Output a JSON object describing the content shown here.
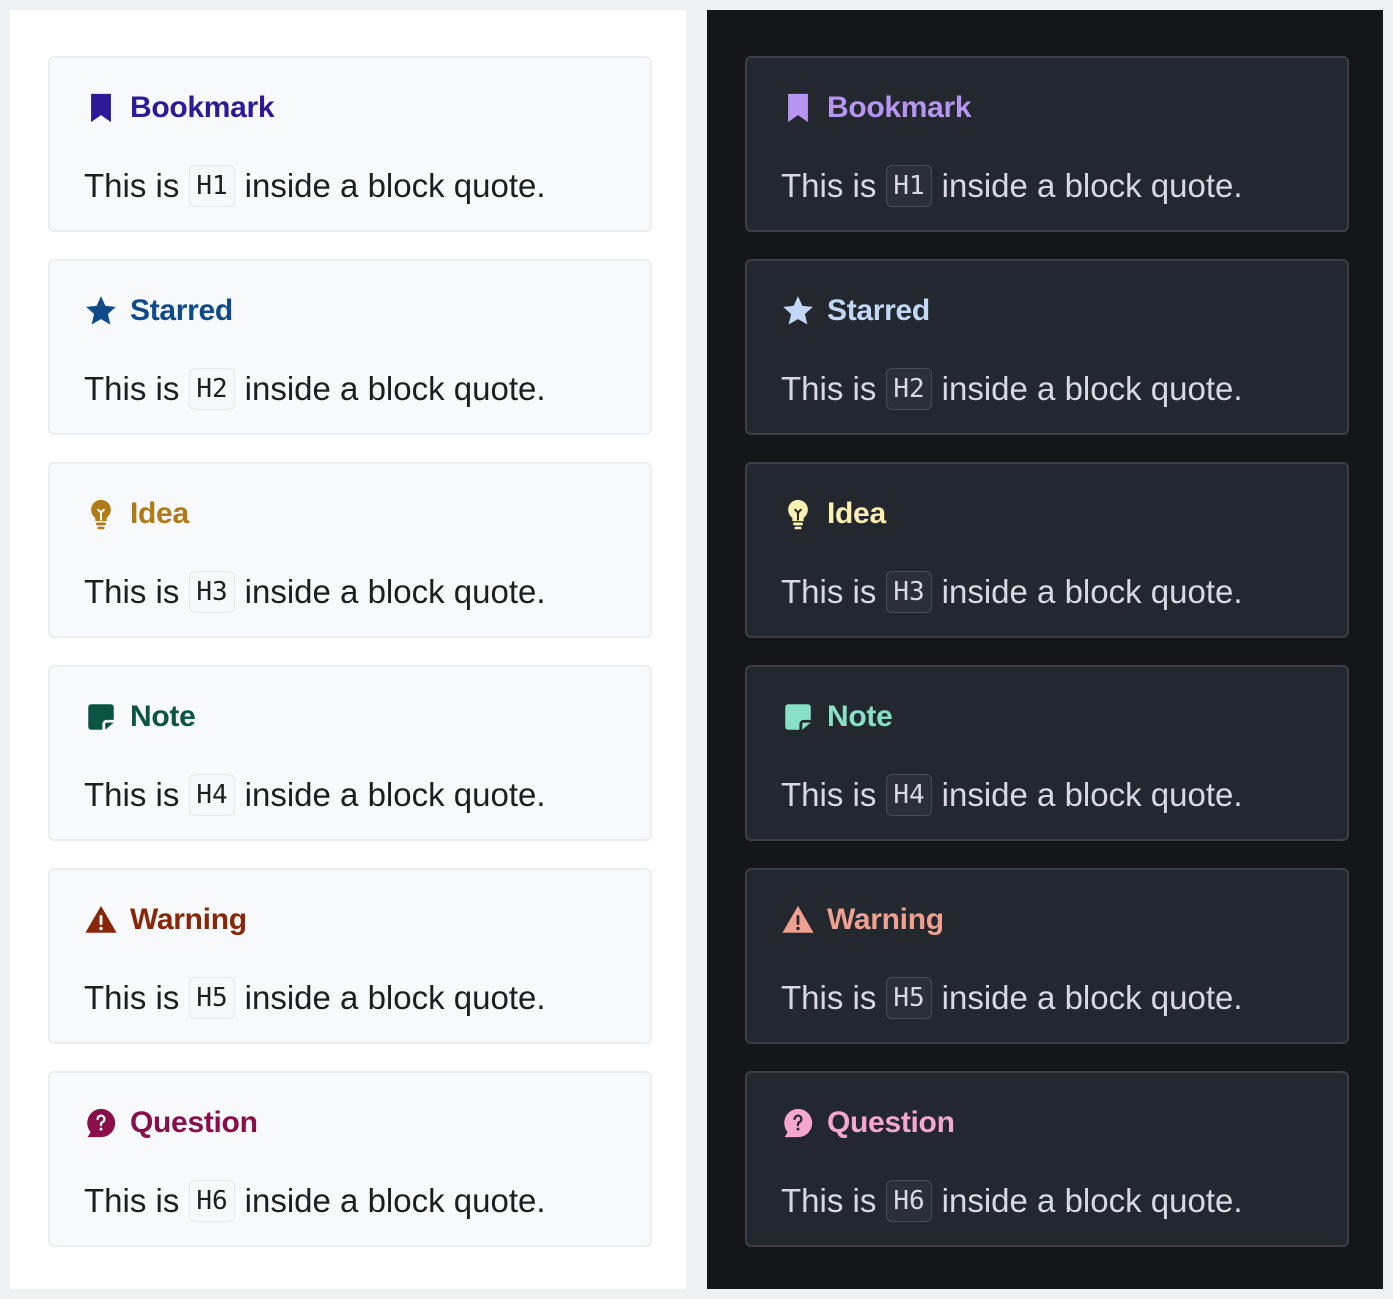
{
  "panels": [
    {
      "theme": "light",
      "callouts": [
        {
          "title": "Bookmark",
          "icon": "bookmark-icon",
          "color": "#2e1a98",
          "prefix": "This is",
          "code": "H1",
          "suffix": "inside a block quote."
        },
        {
          "title": "Starred",
          "icon": "star-icon",
          "color": "#0f4a8a",
          "prefix": "This is",
          "code": "H2",
          "suffix": "inside a block quote."
        },
        {
          "title": "Idea",
          "icon": "lightbulb-icon",
          "color": "#b07a17",
          "prefix": "This is",
          "code": "H3",
          "suffix": "inside a block quote."
        },
        {
          "title": "Note",
          "icon": "sticky-note-icon",
          "color": "#0c5444",
          "prefix": "This is",
          "code": "H4",
          "suffix": "inside a block quote."
        },
        {
          "title": "Warning",
          "icon": "warning-icon",
          "color": "#8a2608",
          "prefix": "This is",
          "code": "H5",
          "suffix": "inside a block quote."
        },
        {
          "title": "Question",
          "icon": "question-bubble-icon",
          "color": "#8a0e4a",
          "prefix": "This is",
          "code": "H6",
          "suffix": "inside a block quote."
        }
      ]
    },
    {
      "theme": "dark",
      "callouts": [
        {
          "title": "Bookmark",
          "icon": "bookmark-icon",
          "color": "#b694f0",
          "prefix": "This is",
          "code": "H1",
          "suffix": "inside a block quote."
        },
        {
          "title": "Starred",
          "icon": "star-icon",
          "color": "#c2d8f8",
          "prefix": "This is",
          "code": "H2",
          "suffix": "inside a block quote."
        },
        {
          "title": "Idea",
          "icon": "lightbulb-icon",
          "color": "#fdf0b0",
          "prefix": "This is",
          "code": "H3",
          "suffix": "inside a block quote."
        },
        {
          "title": "Note",
          "icon": "sticky-note-icon",
          "color": "#88e0c8",
          "prefix": "This is",
          "code": "H4",
          "suffix": "inside a block quote."
        },
        {
          "title": "Warning",
          "icon": "warning-icon",
          "color": "#f0a090",
          "prefix": "This is",
          "code": "H5",
          "suffix": "inside a block quote."
        },
        {
          "title": "Question",
          "icon": "question-bubble-icon",
          "color": "#f6a8ca",
          "prefix": "This is",
          "code": "H6",
          "suffix": "inside a block quote."
        }
      ]
    }
  ]
}
